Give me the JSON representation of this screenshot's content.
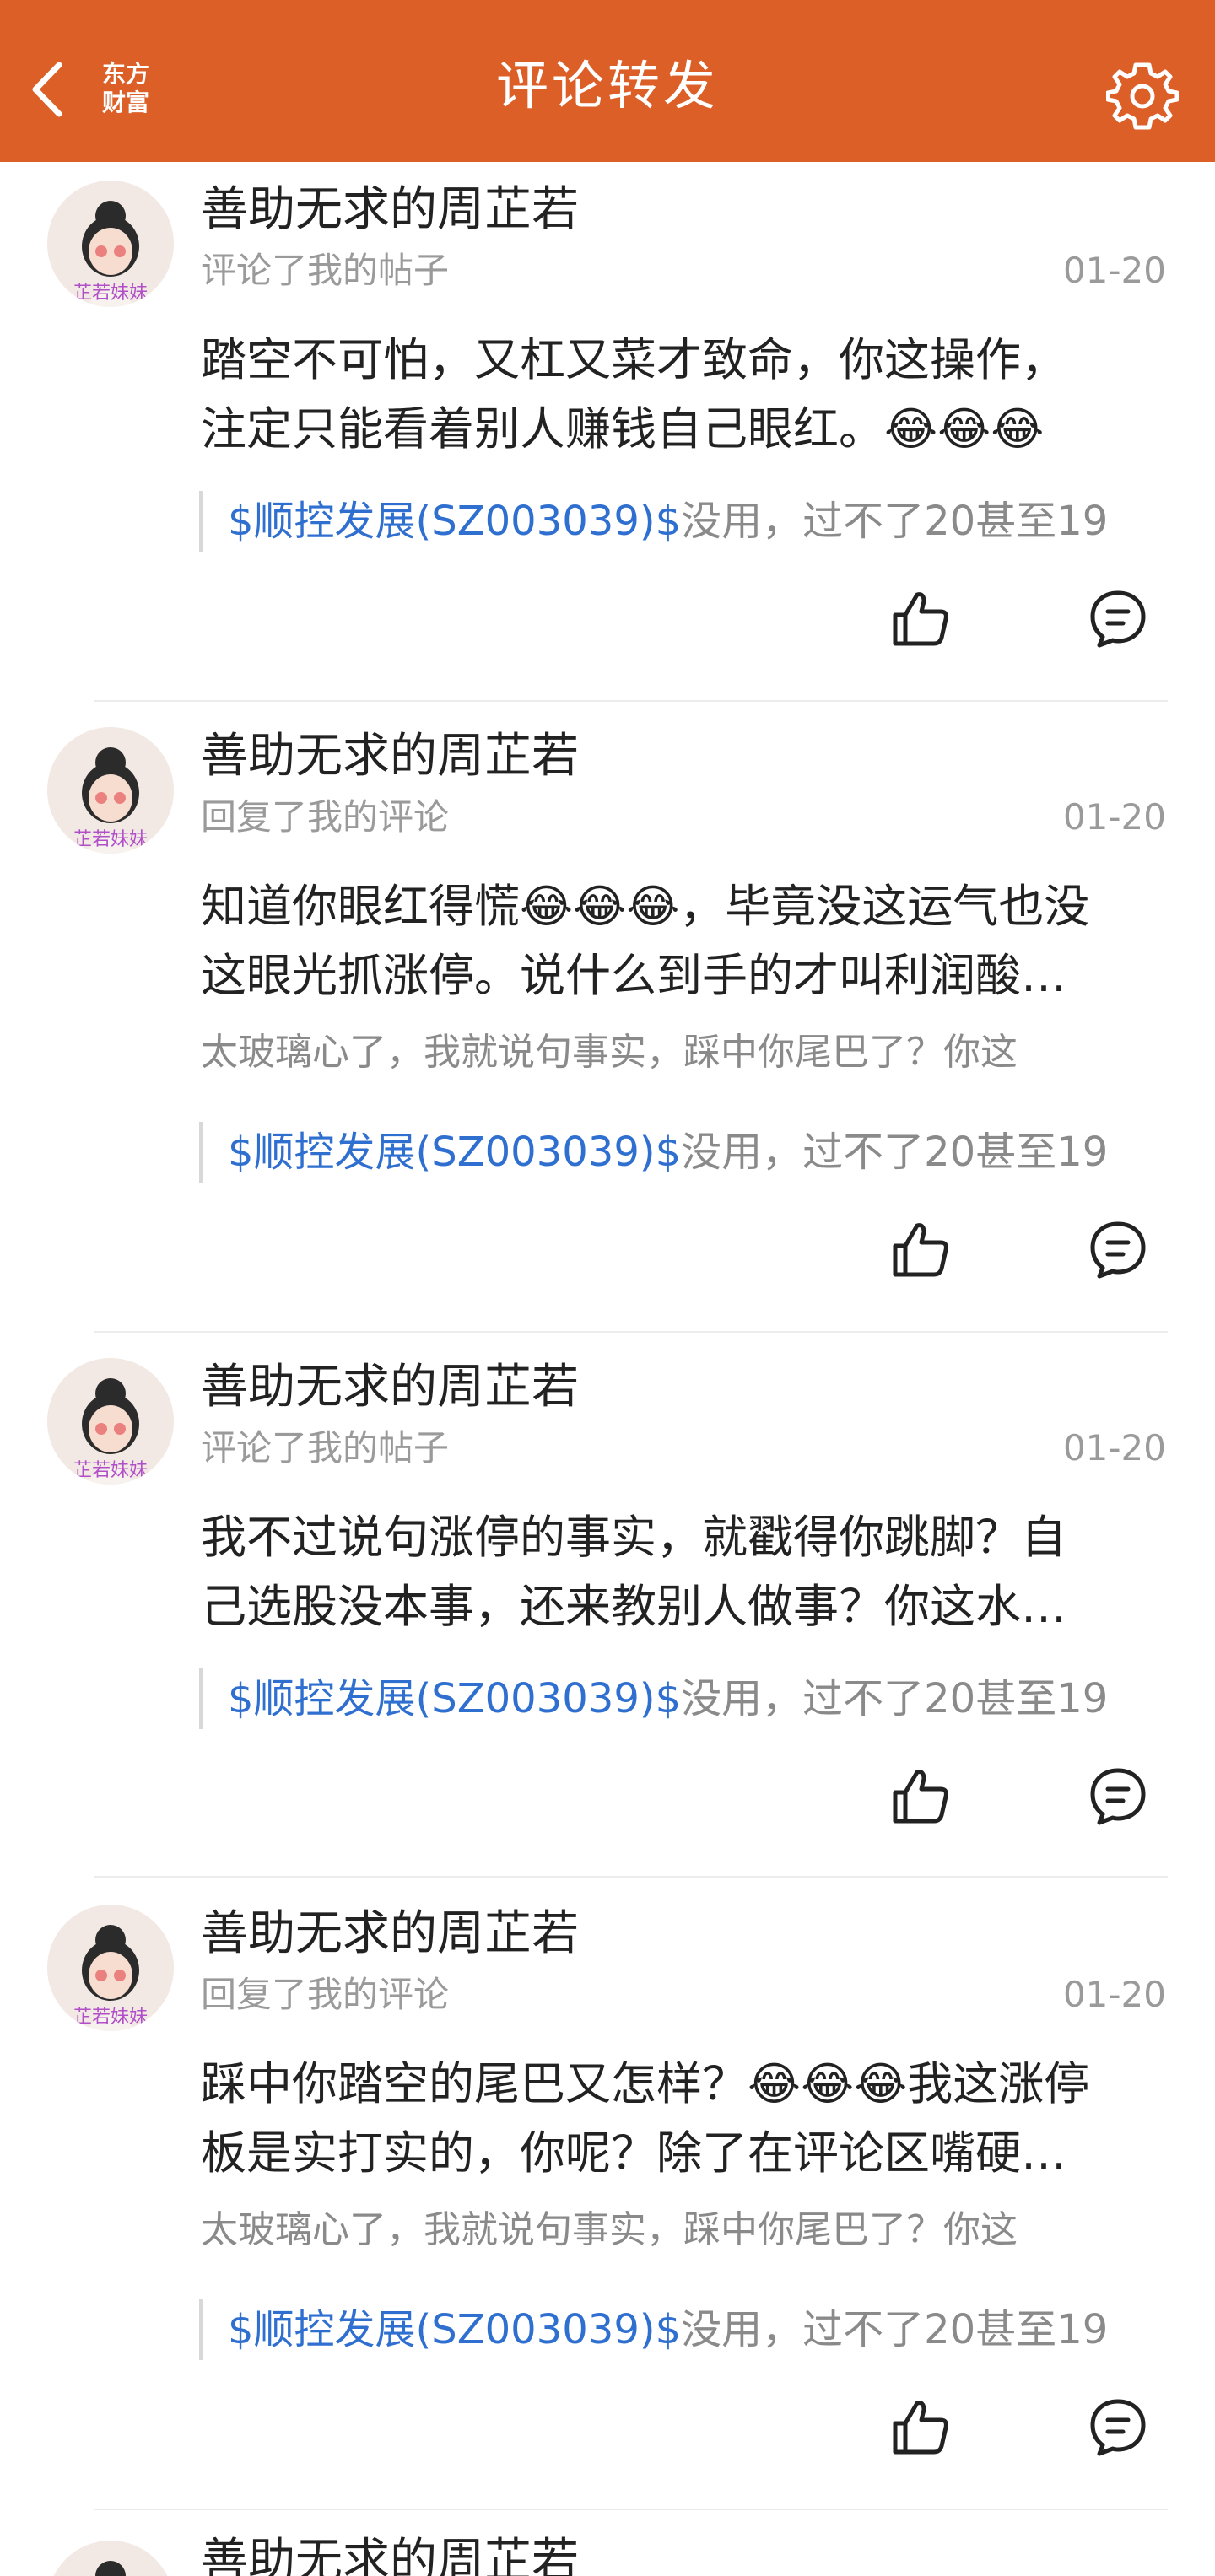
{
  "header": {
    "title": "评论转发",
    "logo_line1": "东方",
    "logo_line2": "财富",
    "accent_color": "#dd5f28"
  },
  "comments": [
    {
      "username": "善助无求的周芷若",
      "action": "评论了我的帖子",
      "date": "01-20",
      "content_lines": [
        "踏空不可怕，又杠又菜才致命，你这操作，",
        "注定只能看着别人赚钱自己眼红。😂😂😂"
      ],
      "reply": "",
      "quote_stock": "$顺控发展(SZ003039)$",
      "quote_text": "没用，过不了20甚至19"
    },
    {
      "username": "善助无求的周芷若",
      "action": "回复了我的评论",
      "date": "01-20",
      "content_lines": [
        "知道你眼红得慌😂😂😂，毕竟没这运气也没",
        "这眼光抓涨停。说什么到手的才叫利润酸…"
      ],
      "reply": "太玻璃心了，我就说句事实，踩中你尾巴了？你这",
      "quote_stock": "$顺控发展(SZ003039)$",
      "quote_text": "没用，过不了20甚至19"
    },
    {
      "username": "善助无求的周芷若",
      "action": "评论了我的帖子",
      "date": "01-20",
      "content_lines": [
        "我不过说句涨停的事实，就戳得你跳脚？自",
        "己选股没本事，还来教别人做事？你这水…"
      ],
      "reply": "",
      "quote_stock": "$顺控发展(SZ003039)$",
      "quote_text": "没用，过不了20甚至19"
    },
    {
      "username": "善助无求的周芷若",
      "action": "回复了我的评论",
      "date": "01-20",
      "content_lines": [
        "踩中你踏空的尾巴又怎样？😂😂😂我这涨停",
        "板是实打实的，你呢？除了在评论区嘴硬…"
      ],
      "reply": "太玻璃心了，我就说句事实，踩中你尾巴了？你这",
      "quote_stock": "$顺控发展(SZ003039)$",
      "quote_text": "没用，过不了20甚至19"
    },
    {
      "username": "善助无求的周芷若",
      "action": "",
      "date": "",
      "content_lines": [],
      "reply": "",
      "quote_stock": "",
      "quote_text": ""
    }
  ],
  "avatar_badge": "芷若妹妹",
  "icons": {
    "back": "chevron-left-icon",
    "settings": "gear-icon",
    "like": "thumbs-up-icon",
    "reply": "comment-icon"
  }
}
